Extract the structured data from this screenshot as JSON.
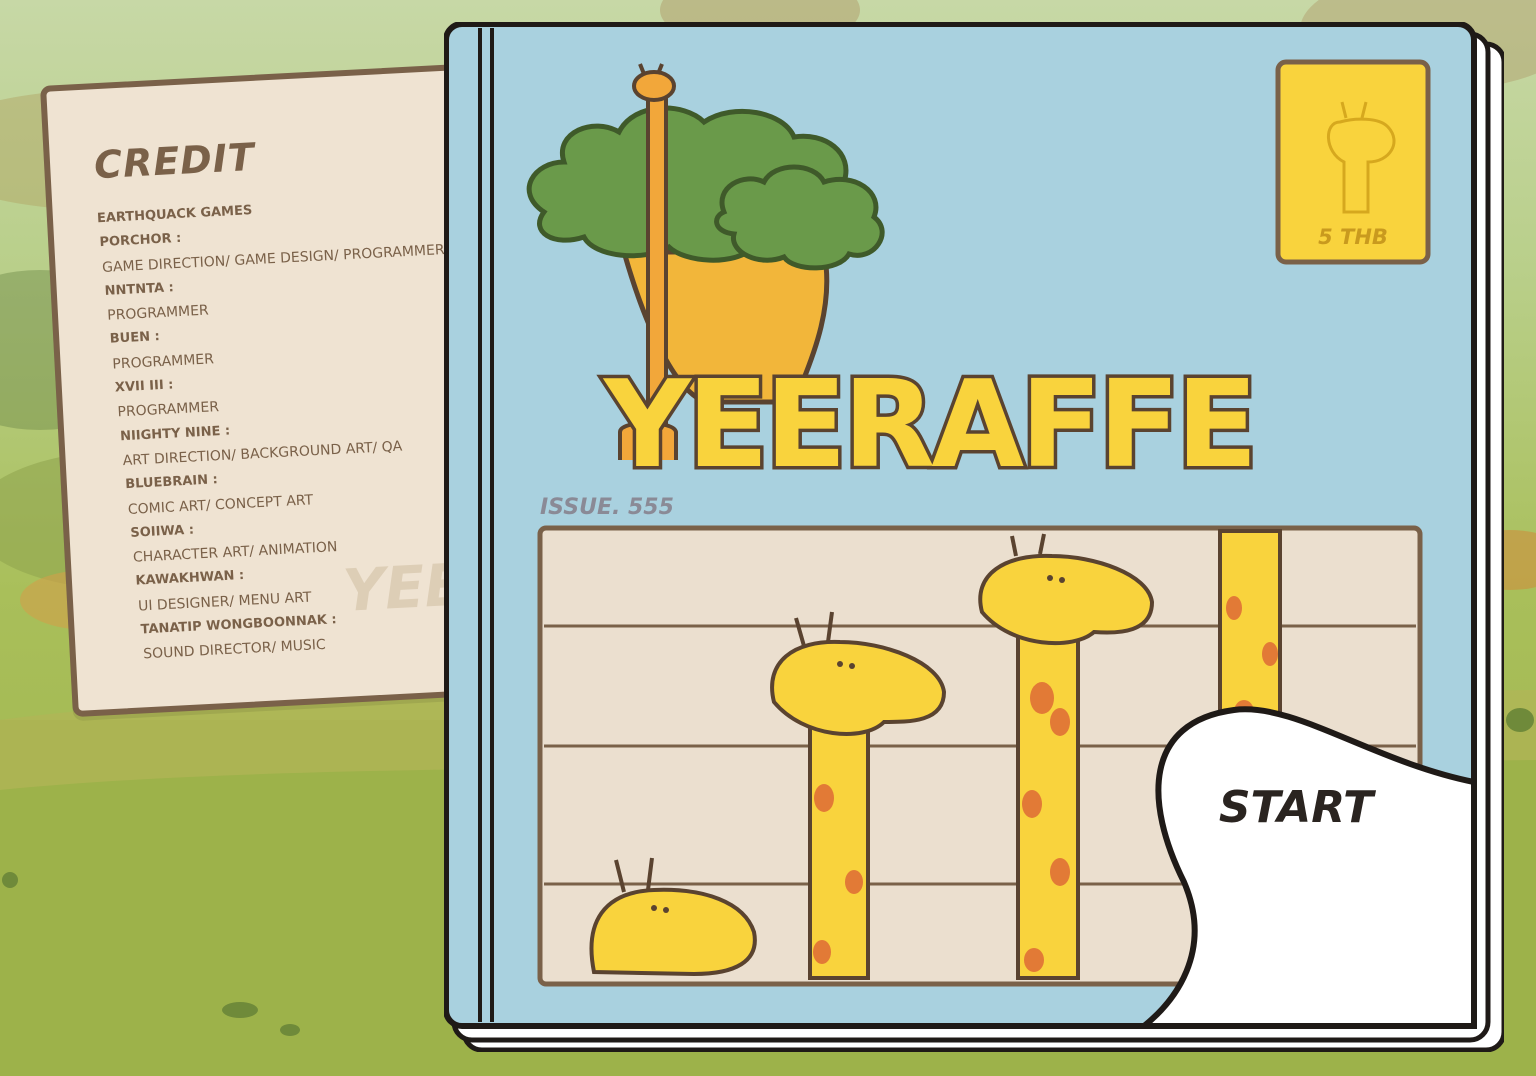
{
  "credits": {
    "title": "CREDIT",
    "lines": [
      {
        "text": "EARTHQUACK GAMES",
        "kind": "name"
      },
      {
        "text": "PORCHOR :",
        "kind": "name"
      },
      {
        "text": "GAME DIRECTION/ GAME DESIGN/ PROGRAMMER",
        "kind": "role"
      },
      {
        "text": "NNTNTA :",
        "kind": "name"
      },
      {
        "text": "PROGRAMMER",
        "kind": "role"
      },
      {
        "text": "BUEN :",
        "kind": "name"
      },
      {
        "text": "PROGRAMMER",
        "kind": "role"
      },
      {
        "text": "XVII III :",
        "kind": "name"
      },
      {
        "text": "PROGRAMMER",
        "kind": "role"
      },
      {
        "text": "NIIGHTY NINE :",
        "kind": "name"
      },
      {
        "text": "ART DIRECTION/ BACKGROUND ART/ QA",
        "kind": "role"
      },
      {
        "text": "BLUEBRAIN :",
        "kind": "name"
      },
      {
        "text": "COMIC ART/ CONCEPT ART",
        "kind": "role"
      },
      {
        "text": "SOIIWA :",
        "kind": "name"
      },
      {
        "text": "CHARACTER ART/ ANIMATION",
        "kind": "role"
      },
      {
        "text": "KAWAKHWAN :",
        "kind": "name"
      },
      {
        "text": "UI DESIGNER/ MENU ART",
        "kind": "role"
      },
      {
        "text": "TANATIP WONGBOONNAK :",
        "kind": "name"
      },
      {
        "text": "SOUND DIRECTOR/ MUSIC",
        "kind": "role"
      }
    ],
    "watermark": "YEE"
  },
  "cover": {
    "logo": "YEERAFFE",
    "price": "5 THB",
    "issue": "ISSUE. 555",
    "start_label": "START"
  },
  "colors": {
    "cover_blue": "#a9d1df",
    "giraffe_yellow": "#f9d33d",
    "spot_orange": "#e27a36",
    "outline": "#5a4330",
    "panel_cream": "#ebdfcf"
  }
}
